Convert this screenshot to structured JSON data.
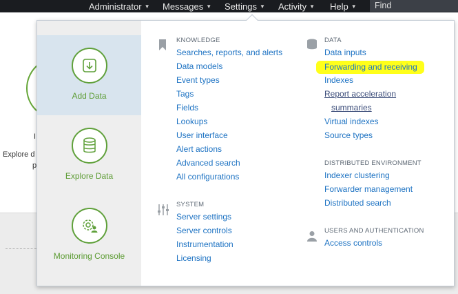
{
  "topbar": {
    "items": [
      {
        "label": "Administrator"
      },
      {
        "label": "Messages"
      },
      {
        "label": "Settings"
      },
      {
        "label": "Activity"
      },
      {
        "label": "Help"
      }
    ],
    "find_label": "Find"
  },
  "background": {
    "fragment_1": "I",
    "fragment_2": "Explore d",
    "fragment_3": "p"
  },
  "apps": [
    {
      "label": "Add Data",
      "icon": "download-icon",
      "active": true
    },
    {
      "label": "Explore Data",
      "icon": "database-icon",
      "active": false
    },
    {
      "label": "Monitoring Console",
      "icon": "gear-user-icon",
      "active": false
    }
  ],
  "knowledge": {
    "heading": "KNOWLEDGE",
    "icon": "bookmark-icon",
    "links": [
      "Searches, reports, and alerts",
      "Data models",
      "Event types",
      "Tags",
      "Fields",
      "Lookups",
      "User interface",
      "Alert actions",
      "Advanced search",
      "All configurations"
    ]
  },
  "system": {
    "heading": "SYSTEM",
    "icon": "sliders-icon",
    "links": [
      "Server settings",
      "Server controls",
      "Instrumentation",
      "Licensing"
    ]
  },
  "data": {
    "heading": "DATA",
    "icon": "cylinder-icon",
    "links": [
      "Data inputs",
      "Forwarding and receiving",
      "Indexes",
      "Report acceleration",
      "summaries",
      "Virtual indexes",
      "Source types"
    ],
    "highlighted": "Forwarding and receiving",
    "highlight_color": "#ffff1a"
  },
  "distributed": {
    "heading": "DISTRIBUTED ENVIRONMENT",
    "links": [
      "Indexer clustering",
      "Forwarder management",
      "Distributed search"
    ]
  },
  "users": {
    "heading": "USERS AND AUTHENTICATION",
    "icon": "user-icon",
    "links": [
      "Access controls"
    ]
  },
  "colors": {
    "link": "#1e73c3",
    "app_green": "#5fa03a",
    "topbar": "#1a1c20"
  }
}
